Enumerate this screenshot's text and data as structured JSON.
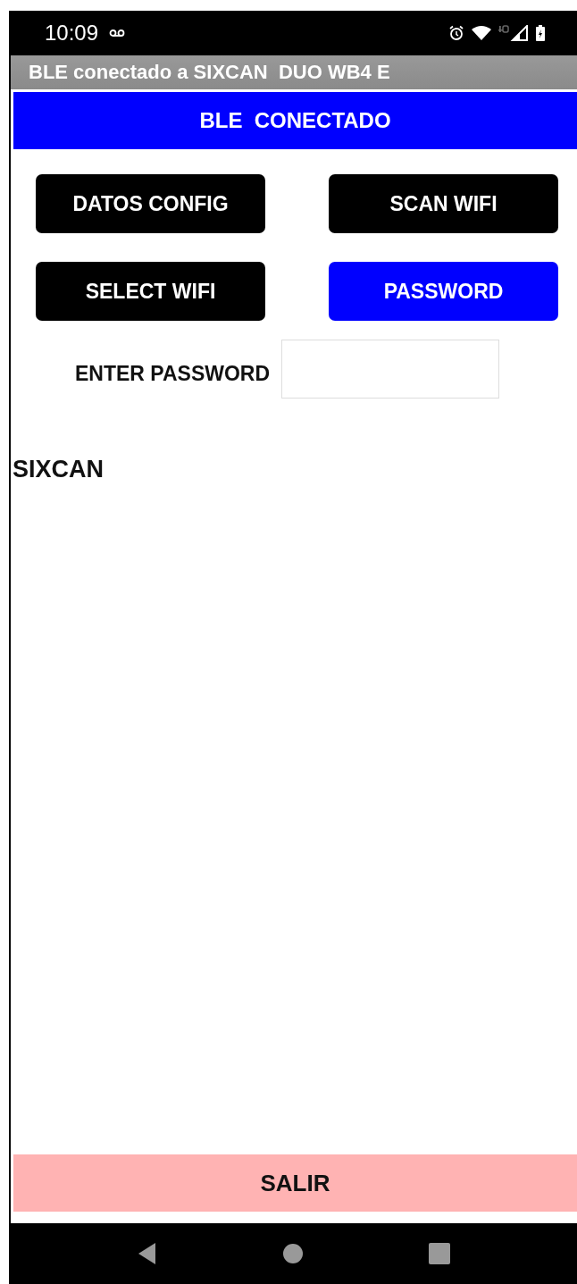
{
  "status_bar": {
    "time": "10:09"
  },
  "title_bar": {
    "title": "BLE conectado a SIXCAN  DUO WB4 E"
  },
  "banner": {
    "text": "BLE  CONECTADO"
  },
  "buttons": [
    {
      "label": "DATOS CONFIG",
      "selected": false
    },
    {
      "label": "SCAN WIFI",
      "selected": false
    },
    {
      "label": "SELECT WIFI",
      "selected": false
    },
    {
      "label": "PASSWORD",
      "selected": true
    }
  ],
  "password": {
    "label": "ENTER PASSWORD"
  },
  "device_name": "SIXCAN",
  "exit_button": {
    "label": "SALIR"
  }
}
